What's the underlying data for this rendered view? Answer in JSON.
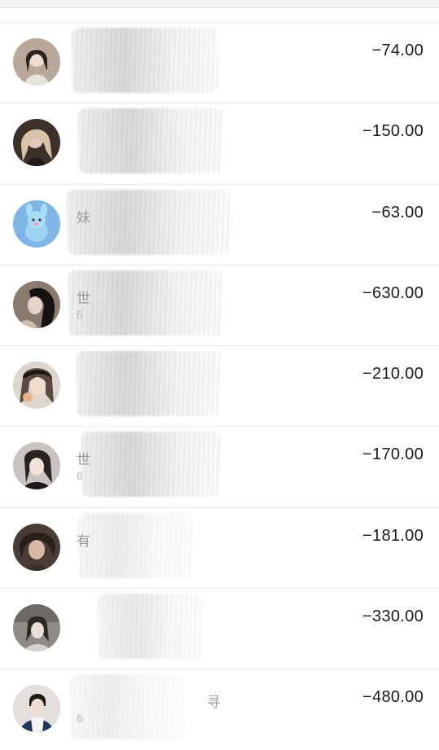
{
  "transactions": [
    {
      "amount": "−74.00",
      "fragment": "",
      "fragment_sub": "",
      "avatar_color": "#b9a79a"
    },
    {
      "amount": "−150.00",
      "fragment": "",
      "fragment_sub": "",
      "avatar_color": "#3d3029"
    },
    {
      "amount": "−63.00",
      "fragment": "妹",
      "fragment_sub": "",
      "avatar_color": "#7fb6e6"
    },
    {
      "amount": "−630.00",
      "fragment": "世",
      "fragment_sub": "6",
      "avatar_color": "#8a7a70"
    },
    {
      "amount": "−210.00",
      "fragment": "",
      "fragment_sub": "",
      "avatar_color": "#5a4a42"
    },
    {
      "amount": "−170.00",
      "fragment": "世",
      "fragment_sub": "6",
      "avatar_color": "#c8c2c0"
    },
    {
      "amount": "−181.00",
      "fragment": "有",
      "fragment_sub": "",
      "avatar_color": "#4a3d37"
    },
    {
      "amount": "−330.00",
      "fragment": "",
      "fragment_sub": "",
      "avatar_color": "#8e8a86"
    },
    {
      "amount": "−480.00",
      "fragment": "寻",
      "fragment_sub": "6",
      "avatar_color": "#b4aeb0"
    }
  ]
}
